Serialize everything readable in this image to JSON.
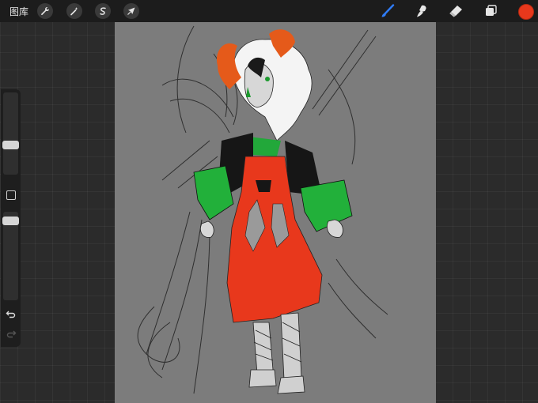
{
  "toolbar": {
    "gallery_label": "图库",
    "left_tools": [
      {
        "name": "actions",
        "icon": "wrench-icon"
      },
      {
        "name": "adjustments",
        "icon": "magic-wand-icon"
      },
      {
        "name": "selection",
        "icon": "selection-s-icon"
      },
      {
        "name": "transform",
        "icon": "arrow-cursor-icon"
      }
    ],
    "right_tools": [
      {
        "name": "brush",
        "icon": "brush-icon",
        "active": true
      },
      {
        "name": "smudge",
        "icon": "smudge-icon"
      },
      {
        "name": "eraser",
        "icon": "eraser-icon"
      },
      {
        "name": "layers",
        "icon": "layers-icon"
      }
    ],
    "current_color": "#e8381c"
  },
  "sidebar": {
    "brush_size_level": 0.63,
    "opacity_level": 0.0,
    "undo_icon": "undo-icon",
    "redo_icon": "redo-icon",
    "modify_icon": "square-icon"
  },
  "colors": {
    "accent_blue": "#2f7cf6",
    "canvas_bg": "#7c7c7c",
    "toolbar_bg": "#1c1c1c"
  }
}
